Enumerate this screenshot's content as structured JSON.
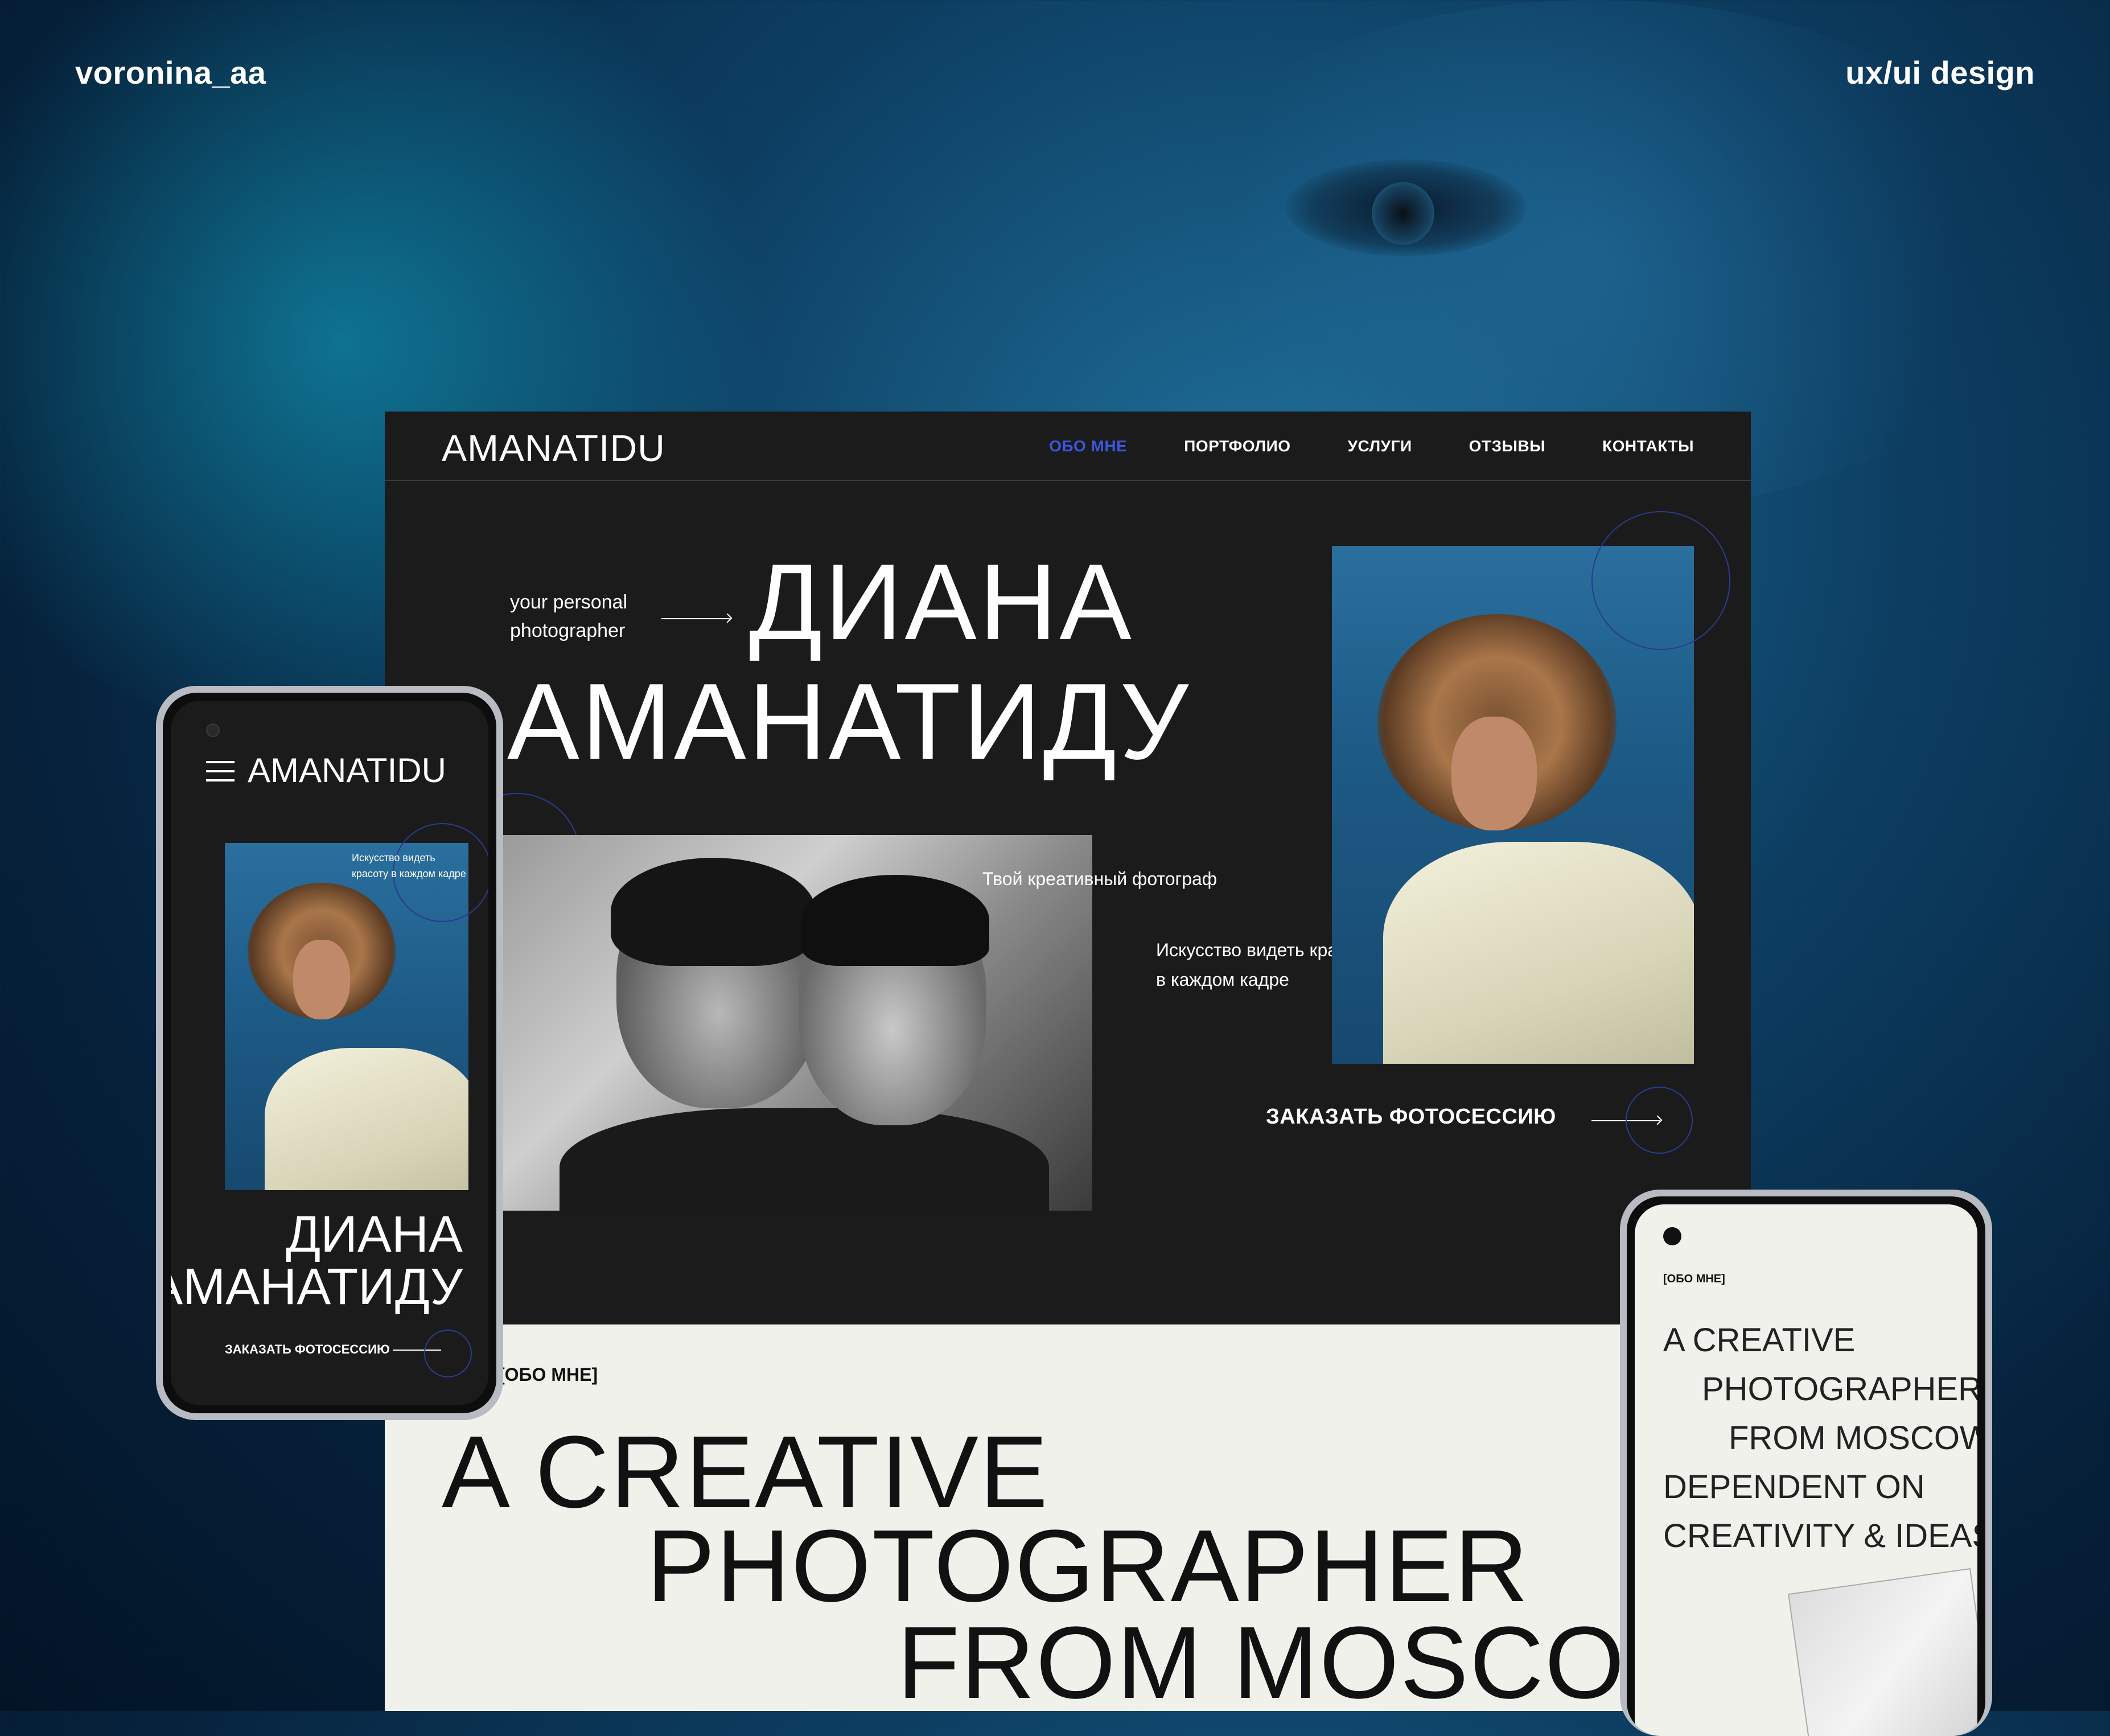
{
  "corner": {
    "left": "voronina_aa",
    "right": "ux/ui design"
  },
  "desktop": {
    "logo": "AMANATIDU",
    "nav": [
      "ОБО МНЕ",
      "ПОРТФОЛИО",
      "УСЛУГИ",
      "ОТЗЫВЫ",
      "КОНТАКТЫ"
    ],
    "active_nav": "ОБО МНЕ",
    "tagline_line1": "your personal",
    "tagline_line2": "photographer",
    "name_line1": "ДИАНА",
    "name_line2": "АМАНАТИДУ",
    "creative_text": "Твой креативный фотограф",
    "art_line1": "Искусство видеть красоту",
    "art_line2": "в каждом кадре",
    "order_button": "ЗАКАЗАТЬ ФОТОСЕССИЮ",
    "about_tag": "[ОБО МНЕ]",
    "big_line1": "A CREATIVE",
    "big_line2": "PHOTOGRAPHER",
    "big_line3": "FROM MOSCOW"
  },
  "phone_left": {
    "logo": "AMANATIDU",
    "photo_text_line1": "Искусство видеть",
    "photo_text_line2": "красоту в каждом кадре",
    "name_line1": "ДИАНА",
    "name_line2": "АМАНАТИДУ",
    "order_button": "ЗАКАЗАТЬ ФОТОСЕССИЮ"
  },
  "phone_right": {
    "tag": "[ОБО МНЕ]",
    "line1": "A CREATIVE",
    "line2": "PHOTOGRAPHER",
    "line3": "FROM MOSCOW",
    "line4": "DEPENDENT ON",
    "line5": "CREATIVITY & IDEAS"
  },
  "colors": {
    "accent": "#3b57e0",
    "dark_bg": "#1b1b1b",
    "light_bg": "#f1f1ec"
  }
}
